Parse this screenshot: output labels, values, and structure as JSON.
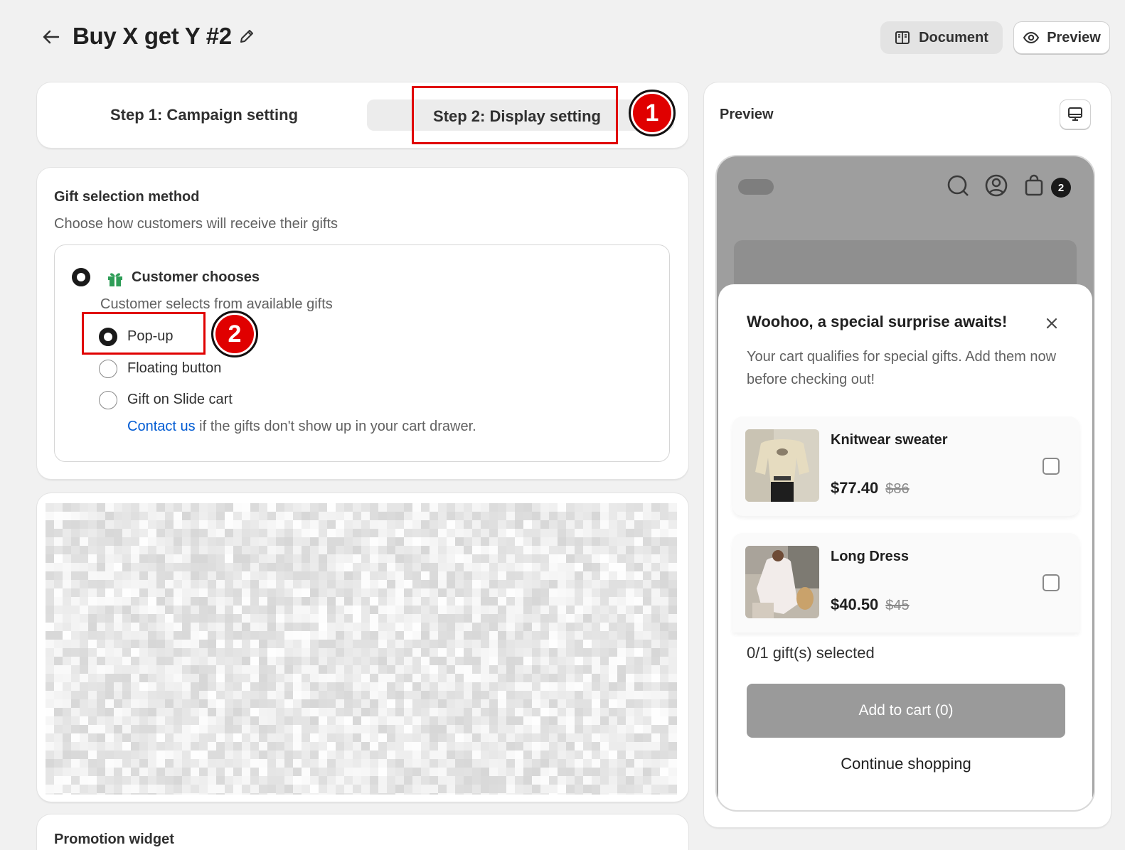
{
  "header": {
    "title": "Buy X get Y #2",
    "document_label": "Document",
    "preview_label": "Preview"
  },
  "steps": {
    "step1_label": "Step 1: Campaign setting",
    "step2_label": "Step 2: Display setting",
    "active": "step2"
  },
  "annotations": {
    "badge1": "1",
    "badge2": "2",
    "color": "#e00000"
  },
  "gift_selection": {
    "title": "Gift selection method",
    "description": "Choose how customers will receive their gifts",
    "option_label": "Customer chooses",
    "option_description": "Customer selects from available gifts",
    "sub_options": [
      {
        "label": "Pop-up",
        "checked": true
      },
      {
        "label": "Floating button",
        "checked": false
      },
      {
        "label": "Gift on Slide cart",
        "checked": false
      }
    ],
    "contact_link": "Contact us",
    "contact_text": " if the gifts don't show up in your cart drawer."
  },
  "promotion_widget": {
    "title": "Promotion widget"
  },
  "preview_panel": {
    "title": "Preview",
    "cart_count": "2",
    "popup": {
      "title": "Woohoo, a special surprise awaits!",
      "description": "Your cart qualifies for special gifts. Add them now before checking out!",
      "products": [
        {
          "name": "Knitwear sweater",
          "price": "$77.40",
          "compare_price": "$86"
        },
        {
          "name": "Long Dress",
          "price": "$40.50",
          "compare_price": "$45"
        }
      ],
      "gift_count": "0/1 gift(s) selected",
      "add_to_cart": "Add to cart (0)",
      "continue": "Continue shopping"
    }
  },
  "colors": {
    "link": "#005bd3",
    "gift_icon": "#2e9d57",
    "annotation_red": "#e00000"
  }
}
